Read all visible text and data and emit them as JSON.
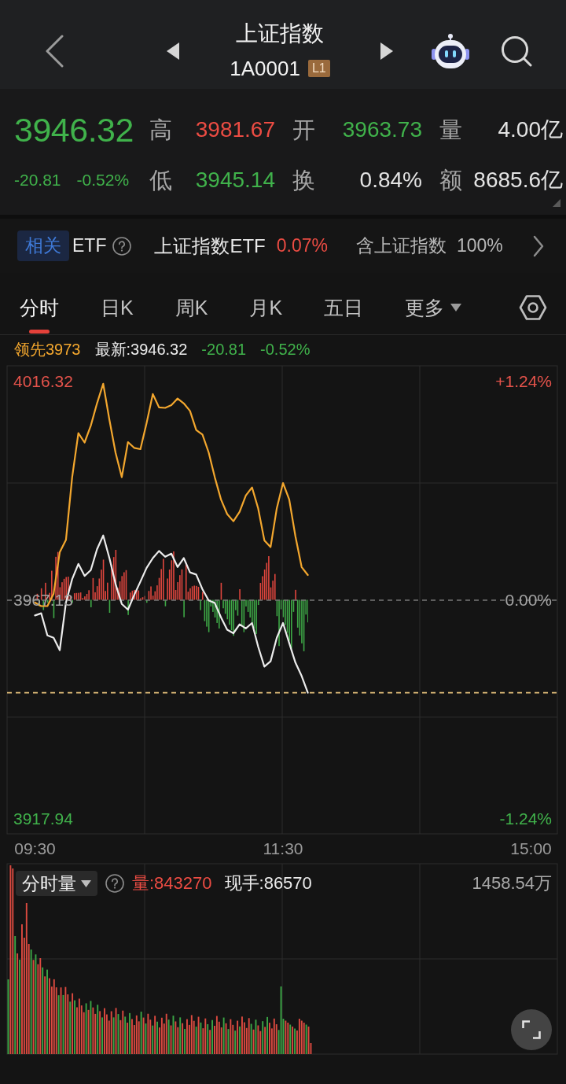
{
  "header": {
    "title": "上证指数",
    "code": "1A0001",
    "level_badge": "L1"
  },
  "quote": {
    "price": "3946.32",
    "change": "-20.81",
    "change_pct": "-0.52%",
    "rising": false,
    "stats": [
      {
        "label": "高",
        "value": "3981.67",
        "color": "#ec4c43"
      },
      {
        "label": "开",
        "value": "3963.73",
        "color": "#40b24b"
      },
      {
        "label": "量",
        "value": "4.00亿",
        "color": "#e4e4e4"
      },
      {
        "label": "低",
        "value": "3945.14",
        "color": "#40b24b"
      },
      {
        "label": "换",
        "value": "0.84%",
        "color": "#e4e4e4"
      },
      {
        "label": "额",
        "value": "8685.6亿",
        "color": "#e4e4e4"
      }
    ]
  },
  "etf_bar": {
    "tag": "相关",
    "label": "ETF",
    "name": "上证指数ETF",
    "change": "0.07%",
    "rising": true,
    "holding_label": "含上证指数",
    "holding_pct": "100%"
  },
  "tabs": [
    {
      "label": "分时",
      "kind": "tab",
      "selected": true
    },
    {
      "label": "日K",
      "kind": "tab",
      "selected": false
    },
    {
      "label": "周K",
      "kind": "tab",
      "selected": false
    },
    {
      "label": "月K",
      "kind": "tab",
      "selected": false
    },
    {
      "label": "五日",
      "kind": "tab",
      "selected": false
    },
    {
      "label": "更多",
      "kind": "menu",
      "selected": false
    }
  ],
  "intraday": {
    "legend_values": [
      "3973",
      ":3946.32"
    ],
    "change": "-20.81",
    "change_pct": "-0.52%",
    "rising": false,
    "right_ticks": [
      "+1.24%",
      "0.00%",
      "-1.24%"
    ],
    "chart_data": {
      "type": "line",
      "categories": [
        "09:30",
        null,
        null,
        null,
        null,
        null,
        null,
        null,
        null,
        null,
        null,
        null,
        null,
        null,
        null,
        null,
        null,
        null,
        null,
        null,
        null,
        null,
        null,
        null,
        null,
        null,
        null,
        null,
        null,
        null,
        null,
        null,
        null,
        null,
        null,
        null,
        null,
        null,
        null,
        null,
        "11:30",
        null,
        null,
        null,
        null,
        null,
        null,
        null,
        null,
        null,
        null,
        null,
        null,
        null,
        null,
        null,
        null,
        null,
        null,
        null,
        null,
        null,
        null,
        null,
        null,
        null,
        null,
        null,
        null,
        null,
        null,
        null,
        null,
        null,
        null,
        null,
        null,
        null,
        null,
        null,
        "15:00"
      ],
      "ylim": [
        3914.58,
        4019.86
      ],
      "yticks": [
        {
          "value": 3917.94,
          "label": "3917.94"
        },
        {
          "value": 3967.13,
          "label": "3967.13"
        },
        {
          "value": 4016.32,
          "label": "4016.32"
        }
      ],
      "ref_lines": [
        {
          "axis": "y",
          "value": 3967.13,
          "color": "#777777"
        },
        {
          "axis": "y",
          "value": 3946.32,
          "color": "#e6c27c"
        }
      ],
      "series": [
        {
          "name": "领先",
          "color": "#f3a72e",
          "values": [
            3966.6,
            3965.8,
            3965.8,
            3968.6,
            3977.9,
            3980.7,
            3994.8,
            4004.7,
            4002.6,
            4006.4,
            4011.4,
            4015.8,
            4007.7,
            4000.3,
            3994.8,
            4002.7,
            4001.4,
            4001.1,
            4007.0,
            4013.5,
            4010.5,
            4010.4,
            4011.0,
            4012.5,
            4011.4,
            4009.7,
            4005.4,
            4004.4,
            4000.4,
            3994.8,
            3989.8,
            3986.5,
            3984.9,
            3987.0,
            3990.7,
            3992.5,
            3987.8,
            3980.6,
            3979.1,
            3987.8,
            3993.5,
            3989.8,
            3981.5,
            3974.6,
            3972.8,
            null,
            null,
            null,
            null,
            null,
            null,
            null,
            null,
            null,
            null,
            null,
            null,
            null,
            null,
            null,
            null,
            null,
            null,
            null,
            null,
            null,
            null,
            null,
            null,
            null,
            null,
            null,
            null,
            null,
            null,
            null,
            null,
            null,
            null,
            null,
            null
          ]
        },
        {
          "name": "最新",
          "color": "#ececec",
          "values": [
            3963.7,
            3964.2,
            3959.2,
            3958.7,
            3955.9,
            3966.6,
            3971.9,
            3975.3,
            3972.6,
            3973.9,
            3978.6,
            3981.7,
            3976.6,
            3970.8,
            3966.3,
            3965.0,
            3968.3,
            3971.3,
            3974.4,
            3976.6,
            3978.2,
            3976.9,
            3977.6,
            3974.6,
            3976.6,
            3973.4,
            3972.9,
            3969.6,
            3967.1,
            3966.5,
            3963.3,
            3960.5,
            3959.7,
            3961.7,
            3960.8,
            3962.0,
            3956.7,
            3952.2,
            3953.4,
            3958.7,
            3962.0,
            3957.5,
            3953.1,
            3950.1,
            3946.3,
            null,
            null,
            null,
            null,
            null,
            null,
            null,
            null,
            null,
            null,
            null,
            null,
            null,
            null,
            null,
            null,
            null,
            null,
            null,
            null,
            null,
            null,
            null,
            null,
            null,
            null,
            null,
            null,
            null,
            null,
            null,
            null,
            null,
            null,
            null,
            null
          ]
        }
      ]
    }
  },
  "volume": {
    "selector": "分时量",
    "volume": "量:843270",
    "current": "现手:86570",
    "max_label": "1458.54万"
  }
}
